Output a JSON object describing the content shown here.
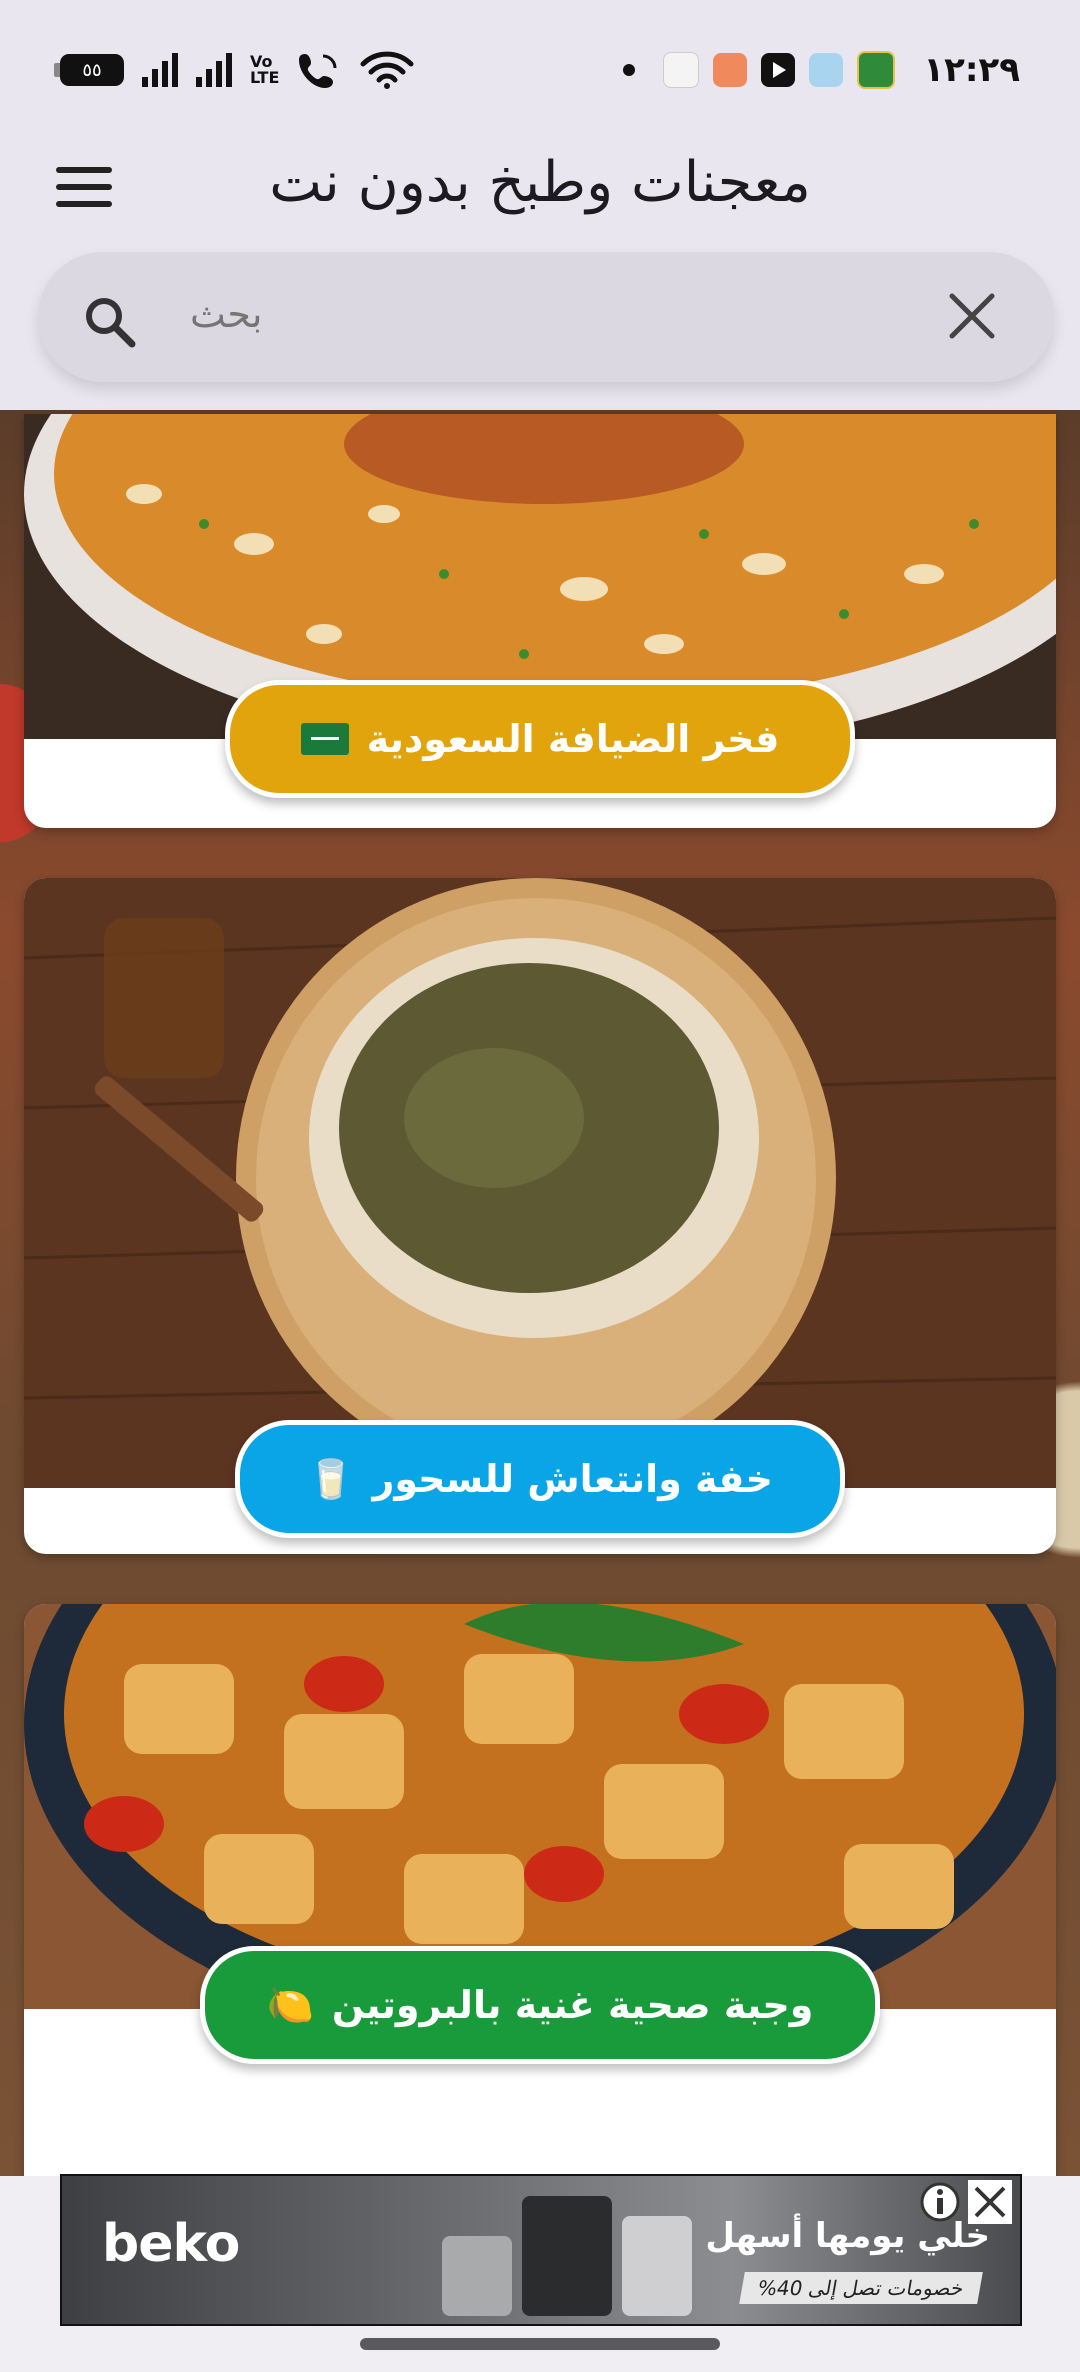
{
  "status_bar": {
    "battery": "٥٥",
    "volte": "Vo\nLTE",
    "time": "١٢:٢٩"
  },
  "app_bar": {
    "title": "معجنات وطبخ بدون نت"
  },
  "search": {
    "placeholder": "بحث"
  },
  "cards": [
    {
      "label": "فخر الضيافة السعودية",
      "emoji": "",
      "color": "#e1a40c"
    },
    {
      "label": "خفة وانتعاش للسحور",
      "emoji": "🥛",
      "color": "#0aa5e6"
    },
    {
      "label": "وجبة صحية غنية بالبروتين",
      "emoji": "🍋",
      "color": "#1a9b3b"
    }
  ],
  "ad": {
    "brand": "beko",
    "headline": "خلي يومها أسهل",
    "subline": "خصومات تصل إلى 40%"
  }
}
